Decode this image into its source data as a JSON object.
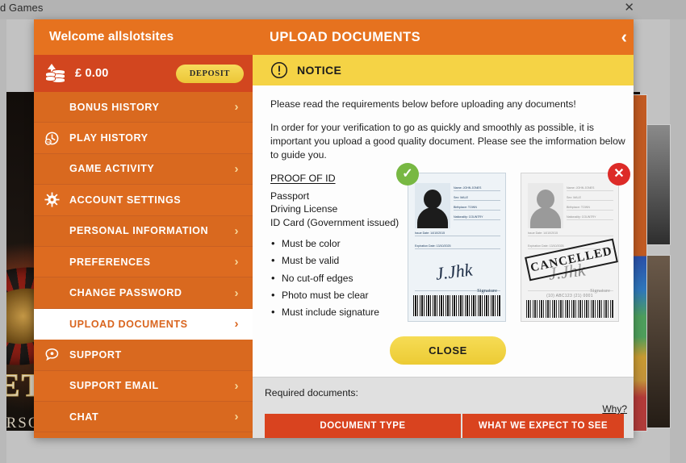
{
  "browser": {
    "tab_title": "d Games",
    "close_icon": "close-icon"
  },
  "background": {
    "hero_word": "ET",
    "hero_sub": "ERSO"
  },
  "sidebar": {
    "welcome": "Welcome allslotsites",
    "balance": {
      "amount": "£ 0.00",
      "icon": "coins-icon",
      "deposit_label": "DEPOSIT"
    },
    "items": [
      {
        "label": "BONUS HISTORY",
        "icon": null,
        "chevron": "›",
        "active": false
      },
      {
        "label": "PLAY HISTORY",
        "icon": "clock-icon",
        "chevron": "",
        "active": false
      },
      {
        "label": "GAME ACTIVITY",
        "icon": null,
        "chevron": "›",
        "active": false
      },
      {
        "label": "ACCOUNT SETTINGS",
        "icon": "gear-icon",
        "chevron": "",
        "active": false
      },
      {
        "label": "PERSONAL INFORMATION",
        "icon": null,
        "chevron": "›",
        "active": false
      },
      {
        "label": "PREFERENCES",
        "icon": null,
        "chevron": "›",
        "active": false
      },
      {
        "label": "CHANGE PASSWORD",
        "icon": null,
        "chevron": "›",
        "active": false
      },
      {
        "label": "UPLOAD DOCUMENTS",
        "icon": null,
        "chevron": "›",
        "active": true
      },
      {
        "label": "SUPPORT",
        "icon": "chat-icon",
        "chevron": "",
        "active": false
      },
      {
        "label": "SUPPORT EMAIL",
        "icon": null,
        "chevron": "›",
        "active": false
      },
      {
        "label": "CHAT",
        "icon": null,
        "chevron": "›",
        "active": false
      }
    ]
  },
  "content": {
    "title": "UPLOAD DOCUMENTS",
    "back_icon": "chevron-left-icon",
    "notice": {
      "icon": "exclamation-circle-icon",
      "label": "NOTICE"
    },
    "lead": "Please read the requirements below before uploading any documents!",
    "lead2": "In order for your verification to go as quickly and smoothly as possible, it is important you upload a good quality document. Please see the imformation below to guide you.",
    "proof": {
      "title": "PROOF OF ID",
      "doc_types": "Passport\nDriving License\nID Card (Government issued)",
      "requirements": [
        "Must be color",
        "Must be valid",
        "No cut-off edges",
        "Photo must be clear",
        "Must include signature"
      ]
    },
    "card_good": {
      "badge": "✓",
      "name": "Name: JOHN JONES",
      "sex": "Sex: MALE",
      "birthplace": "Birthplace: TOWN",
      "nationality": "Nationality: COUNTRY",
      "issue_date": "Issue Date: 14/10/2015",
      "expiration_date": "Expiration Date: 13/10/2025",
      "signature_label": "Signature"
    },
    "card_bad": {
      "badge": "✕",
      "name": "Name: JOHN JONES",
      "sex": "Sex: MALE",
      "birthplace": "Birthplace: TOWN",
      "nationality": "Nationality: COUNTRY",
      "issue_date": "Issue Date: 14/10/2015",
      "expiration_date": "Expiration Date: 13/10/2025",
      "signature_label": "Signature",
      "stamp": "CANCELLED",
      "barcode_text": "(10) ABC123 (21) 0001"
    },
    "close_label": "CLOSE",
    "required": {
      "label": "Required documents:",
      "why_label": "Why?",
      "columns": [
        "DOCUMENT TYPE",
        "WHAT WE EXPECT TO SEE"
      ]
    }
  },
  "colors": {
    "orange_header": "#e6721f",
    "orange_sidebar": "#d9691f",
    "red_balance": "#d2461f",
    "yellow_notice": "#f5d345",
    "yellow_button": "#f0d044",
    "red_table": "#d9431f",
    "green_badge": "#78b843",
    "red_badge": "#dd2b28"
  }
}
